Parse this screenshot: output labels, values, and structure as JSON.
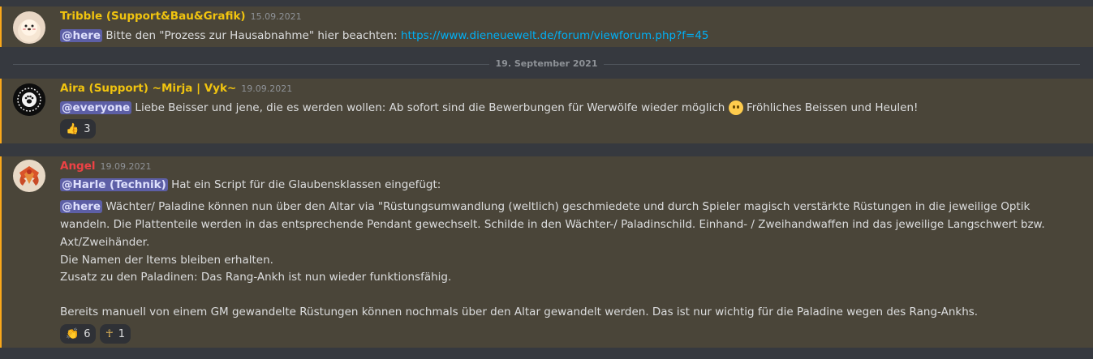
{
  "messages": [
    {
      "author": "Tribble (Support&Bau&Grafik)",
      "author_color": "#f1c40f",
      "timestamp": "15.09.2021",
      "mention": "@here",
      "text": " Bitte den \"Prozess zur Hausabnahme\" hier beachten: ",
      "link": "https://www.dieneuewelt.de/forum/viewforum.php?f=45"
    },
    {
      "author": "Aira (Support) ~Mirja | Vyk~",
      "author_color": "#f1c40f",
      "timestamp": "19.09.2021",
      "mention": "@everyone",
      "text_before_emoji": " Liebe Beisser und jene, die es werden wollen: Ab sofort sind die Bewerbungen für Werwölfe wieder möglich ",
      "emoji": "slightly-smiling-face",
      "text_after_emoji": " Fröhliches Beissen und Heulen!",
      "reaction": {
        "emoji": "👍",
        "count": "3"
      }
    },
    {
      "author": "Angel",
      "author_color": "#ed4245",
      "timestamp": "19.09.2021",
      "line1_mention": "@Harle (Technik)",
      "line1_text": " Hat ein Script für die Glaubensklassen eingefügt:",
      "line2_mention": "@here",
      "line2_text": " Wächter/ Paladine können nun über den Altar via \"Rüstungsumwandlung (weltlich) geschmiedete und durch Spieler magisch verstärkte Rüstungen in die jeweilige Optik",
      "line3": "wandeln. Die Plattenteile werden in das entsprechende Pendant gewechselt. Schilde in den Wächter-/ Paladinschild. Einhand- / Zweihandwaffen ind das jeweilige Langschwert bzw.",
      "line4": "Axt/Zweihänder.",
      "line5": "Die Namen der Items bleiben erhalten.",
      "line6": "Zusatz zu den Paladinen: Das Rang-Ankh ist nun wieder funktionsfähig.",
      "line7": "Bereits manuell von einem GM gewandelte Rüstungen können nochmals über den Altar gewandelt werden. Das ist nur wichtig für die Paladine wegen des Rang-Ankhs.",
      "reactions": [
        {
          "emoji": "👏",
          "count": "6"
        },
        {
          "emoji": "☥",
          "count": "1"
        }
      ]
    }
  ],
  "date_divider": "19. September 2021"
}
